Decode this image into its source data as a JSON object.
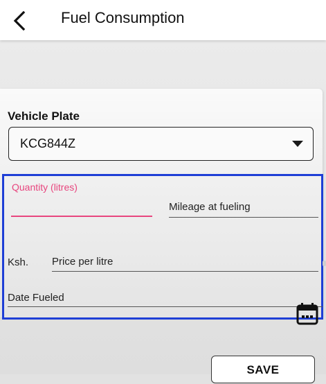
{
  "appbar": {
    "title": "Fuel Consumption",
    "back_icon": "chevron-left-icon"
  },
  "form": {
    "vehicle_plate": {
      "label": "Vehicle Plate",
      "selected": "KCG844Z"
    },
    "quantity": {
      "label": "Quantity (litres)",
      "value": ""
    },
    "mileage": {
      "placeholder": "Mileage at fueling"
    },
    "price": {
      "prefix": "Ksh.",
      "placeholder": "Price per litre"
    },
    "date": {
      "placeholder": "Date Fueled",
      "icon": "calendar-icon"
    },
    "save_label": "SAVE"
  },
  "colors": {
    "focus": "#e8457e",
    "highlight_border": "#1e3ed6",
    "text": "#111111"
  }
}
